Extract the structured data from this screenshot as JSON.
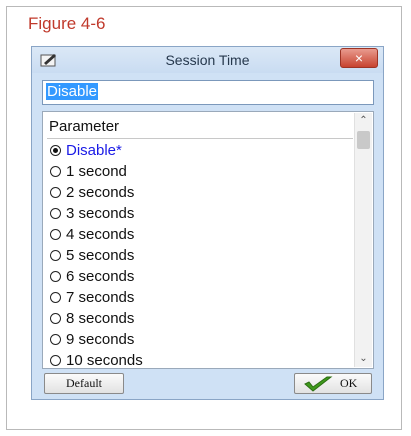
{
  "figure": {
    "title": "Figure 4-6"
  },
  "dialog": {
    "title": "Session Time",
    "close_label": "×",
    "value": "Disable",
    "list": {
      "header": "Parameter",
      "options": [
        {
          "label": "Disable*",
          "selected": true
        },
        {
          "label": "1 second",
          "selected": false
        },
        {
          "label": "2 seconds",
          "selected": false
        },
        {
          "label": "3 seconds",
          "selected": false
        },
        {
          "label": "4 seconds",
          "selected": false
        },
        {
          "label": "5 seconds",
          "selected": false
        },
        {
          "label": "6 seconds",
          "selected": false
        },
        {
          "label": "7 seconds",
          "selected": false
        },
        {
          "label": "8 seconds",
          "selected": false
        },
        {
          "label": "9 seconds",
          "selected": false
        },
        {
          "label": "10 seconds",
          "selected": false
        }
      ]
    },
    "buttons": {
      "default_label": "Default",
      "ok_label": "OK"
    }
  },
  "icons": {
    "app": "pen-icon",
    "ok": "checkmark-icon",
    "close": "close-icon"
  },
  "colors": {
    "figure_title": "#c0392b",
    "selected_option": "#1a1ae6",
    "selection_highlight": "#3399ff",
    "close_button": "#c7432f",
    "checkmark": "#3f9a1c"
  }
}
